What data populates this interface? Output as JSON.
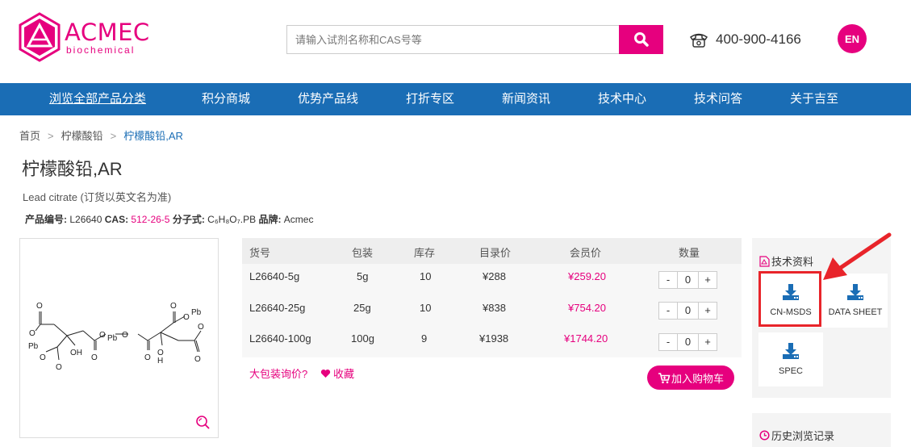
{
  "colors": {
    "brand": "#e6007e",
    "nav": "#1a6db5",
    "highlight": "#e8242a"
  },
  "header": {
    "logo_text": "ACMEC",
    "logo_sub": "biochemical",
    "search_placeholder": "请输入试剂名称和CAS号等",
    "phone": "400-900-4166",
    "lang": "EN"
  },
  "nav": [
    "浏览全部产品分类",
    "积分商城",
    "优势产品线",
    "打折专区",
    "新闻资讯",
    "技术中心",
    "技术问答",
    "关于吉至"
  ],
  "breadcrumb": {
    "home": "首页",
    "sep": ">",
    "category": "柠檬酸铅",
    "current": "柠檬酸铅,AR"
  },
  "product": {
    "title": "柠檬酸铅,AR",
    "english": "Lead citrate (订货以英文名为准)",
    "code_label": "产品编号:",
    "code": "L26640",
    "cas_label": "CAS:",
    "cas": "512-26-5",
    "formula_label": "分子式:",
    "formula": "C₆H₈O₇.PB",
    "brand_label": "品牌:",
    "brand": "Acmec"
  },
  "table": {
    "headers": [
      "货号",
      "包装",
      "库存",
      "目录价",
      "会员价",
      "数量"
    ],
    "rows": [
      {
        "sku": "L26640-5g",
        "pack": "5g",
        "stock": "10",
        "list": "¥288",
        "member": "¥259.20",
        "qty": "0"
      },
      {
        "sku": "L26640-25g",
        "pack": "25g",
        "stock": "10",
        "list": "¥838",
        "member": "¥754.20",
        "qty": "0"
      },
      {
        "sku": "L26640-100g",
        "pack": "100g",
        "stock": "9",
        "list": "¥1938",
        "member": "¥1744.20",
        "qty": "0"
      }
    ],
    "minus": "-",
    "plus": "+"
  },
  "actions": {
    "bulk": "大包装询价?",
    "fav": "收藏",
    "cart": "加入购物车"
  },
  "tech": {
    "title": "技术资料",
    "items": [
      "CN-MSDS",
      "DATA SHEET",
      "SPEC"
    ]
  },
  "history": {
    "title": "历史浏览记录"
  }
}
